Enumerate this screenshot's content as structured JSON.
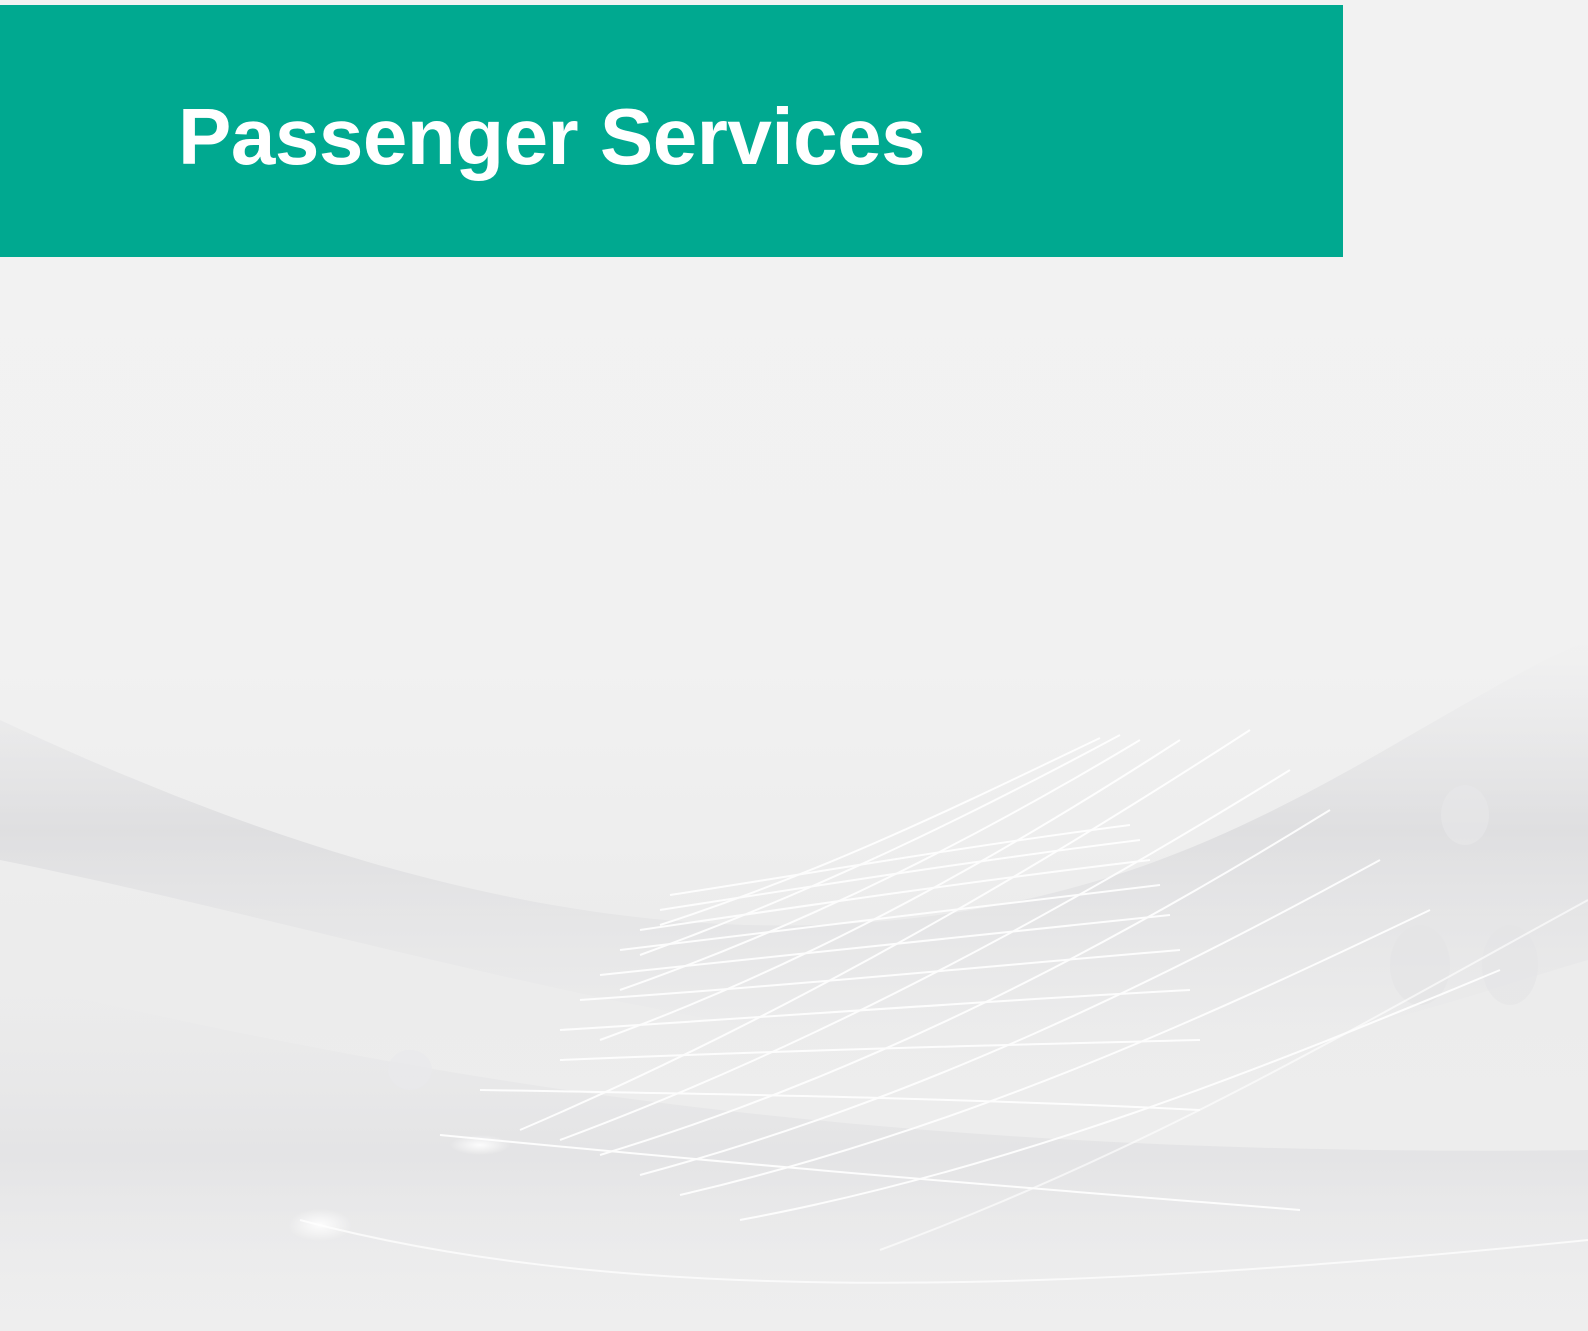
{
  "banner": {
    "title": "Passenger Services"
  },
  "colors": {
    "banner_background": "#00a990",
    "title_text": "#ffffff",
    "page_background": "#f1f1f1"
  }
}
